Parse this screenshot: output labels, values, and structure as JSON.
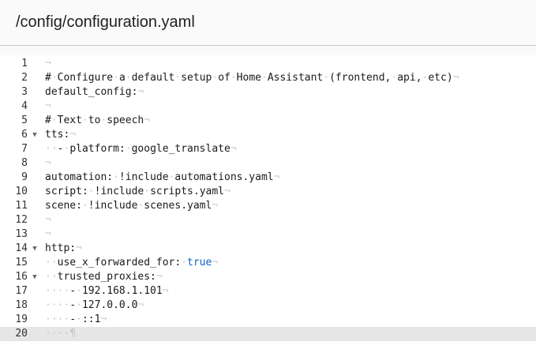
{
  "header": {
    "file_path": "/config/configuration.yaml"
  },
  "editor": {
    "active_line": 20,
    "lines": [
      {
        "n": "1",
        "fold": false,
        "text": ""
      },
      {
        "n": "2",
        "fold": false,
        "text": "# Configure a default setup of Home Assistant (frontend, api, etc)"
      },
      {
        "n": "3",
        "fold": false,
        "text": "default_config:"
      },
      {
        "n": "4",
        "fold": false,
        "text": ""
      },
      {
        "n": "5",
        "fold": false,
        "text": "# Text to speech"
      },
      {
        "n": "6",
        "fold": true,
        "text": "tts:"
      },
      {
        "n": "7",
        "fold": false,
        "text": "  - platform: google_translate"
      },
      {
        "n": "8",
        "fold": false,
        "text": ""
      },
      {
        "n": "9",
        "fold": false,
        "text": "automation: !include automations.yaml"
      },
      {
        "n": "10",
        "fold": false,
        "text": "script: !include scripts.yaml"
      },
      {
        "n": "11",
        "fold": false,
        "text": "scene: !include scenes.yaml"
      },
      {
        "n": "12",
        "fold": false,
        "text": ""
      },
      {
        "n": "13",
        "fold": false,
        "text": ""
      },
      {
        "n": "14",
        "fold": true,
        "text": "http:"
      },
      {
        "n": "15",
        "fold": false,
        "text": "  use_x_forwarded_for: true"
      },
      {
        "n": "16",
        "fold": true,
        "text": "  trusted_proxies:"
      },
      {
        "n": "17",
        "fold": false,
        "text": "    - 192.168.1.101"
      },
      {
        "n": "18",
        "fold": false,
        "text": "    - 127.0.0.0"
      },
      {
        "n": "19",
        "fold": false,
        "text": "    - ::1"
      },
      {
        "n": "20",
        "fold": false,
        "text": "    "
      }
    ]
  },
  "colors": {
    "boolean": "#0b63c7",
    "whitespace_marker": "#c7c7c7",
    "active_line_bg": "#e6e6e6"
  },
  "icons": {
    "fold_marker": "triangle-down-icon",
    "line_end": "not-sign",
    "last_line_end": "pilcrow"
  }
}
